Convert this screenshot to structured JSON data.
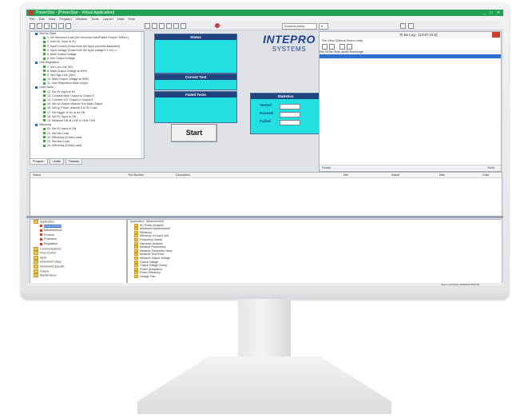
{
  "app": {
    "title": "PowerStar - [PowerStar - Virtual Application]",
    "window_controls": "_ □ ✕",
    "menu": [
      "File",
      "Edit",
      "View",
      "Program",
      "Window",
      "Tools",
      "Launch",
      "Data",
      "Help"
    ],
    "toolbar_combos": [
      "Autotest setup",
      "▾"
    ]
  },
  "colors": {
    "titlebar": "#21a152",
    "panel_header": "#20447e",
    "panel_fill": "#22e0e0",
    "logo": "#1f3f91",
    "selection": "#2f6fd0"
  },
  "tree": {
    "rows": [
      {
        "text": "Test for Tests",
        "type": "hd"
      },
      {
        "text": "1. Vin Minimum Load (Vin minimum load/Rated Output / 5Whrs.)",
        "type": "tk"
      },
      {
        "text": "2. Vout 5V, Input to 5V",
        "type": "tk"
      },
      {
        "text": "3. Input Current (Draw from the input current's datasheet)",
        "type": "tk"
      },
      {
        "text": "4. Input Voltage (Draw from the input voltage's 1.4V) <=",
        "type": "tk"
      },
      {
        "text": "5. Main Output Voltage",
        "type": "tk"
      },
      {
        "text": "6. Aux Output Voltage",
        "type": "tk"
      },
      {
        "text": "Line Regulation",
        "type": "hd"
      },
      {
        "text": "7. Set Low Line (5V)",
        "type": "tk"
      },
      {
        "text": "8. Main Output Voltage at 90Hz",
        "type": "tk"
      },
      {
        "text": "9. Set High Line (26V)",
        "type": "tk"
      },
      {
        "text": "10. Main Output Voltage at 90Hz",
        "type": "tk"
      },
      {
        "text": "11. Line Regulation Main Output",
        "type": "tk"
      },
      {
        "text": "Load Value",
        "type": "hd"
      },
      {
        "text": "12. Set 5V Input to 5V",
        "type": "tk"
      },
      {
        "text": "13. Connect Main Output to Output 5",
        "type": "tk"
      },
      {
        "text": "14. Connect 12V Output to Output 6",
        "type": "tk"
      },
      {
        "text": "15. Set up Output channel 5 to Main Output",
        "type": "tk"
      },
      {
        "text": "16. Set up Power channel 6 to 5V Load",
        "type": "tk"
      },
      {
        "text": "17. Set trigger to 5V at an ON",
        "type": "tk"
      },
      {
        "text": "18. Set 5V Input to ON",
        "type": "tk"
      },
      {
        "text": "19. Measure ON at CHN & CHN CHN",
        "type": "tk"
      },
      {
        "text": "Efficiency",
        "type": "hd"
      },
      {
        "text": "20. Set 5V Input to ON",
        "type": "tk"
      },
      {
        "text": "21. Set Min Load",
        "type": "tk"
      },
      {
        "text": "22. Efficiency (8 Max Load)",
        "type": "tk"
      },
      {
        "text": "23. Set Max Load",
        "type": "tk"
      },
      {
        "text": "24. Efficiency (8 Max Load)",
        "type": "tk"
      }
    ],
    "tabs": [
      "Program",
      "Limits",
      "Fixtures"
    ]
  },
  "panels": {
    "status_label": "Status",
    "current_test_label": "Current Test",
    "failed_tests_label": "Failed Tests",
    "start_label": "Start",
    "logo_line1": "INTEPRO",
    "logo_line2": "SYSTEMS",
    "statistics_label": "Statistics",
    "tested_label": "Tested",
    "passed_label": "Passed",
    "failed_label": "Failed"
  },
  "log": {
    "title": "Ts Bs Log - [13:57:03.0]",
    "menu": "File  View  Options  Search  Help",
    "columns": "Nbr    Ts/Tac    Ts/ac    ad/dB    Rmessage",
    "status_left": "Ready",
    "status_right": "Build"
  },
  "results": {
    "columns": [
      {
        "label": "Status"
      },
      {
        "label": "Test Number"
      },
      {
        "label": "Description"
      },
      {
        "label": "Min"
      },
      {
        "label": "Actual"
      },
      {
        "label": "Max"
      },
      {
        "label": "Units"
      }
    ]
  },
  "bottom_tree": {
    "rows": [
      {
        "text": "Application",
        "kind": "fold"
      },
      {
        "text": "Measurement",
        "kind": "red",
        "selected": true
      },
      {
        "text": "Miscellaneous",
        "kind": "red"
      },
      {
        "text": "Process",
        "kind": "red"
      },
      {
        "text": "Protection",
        "kind": "red"
      },
      {
        "text": "Regulation",
        "kind": "red"
      },
      {
        "text": "Communications",
        "kind": "fold"
      },
      {
        "text": "Flow Control",
        "kind": "fold"
      },
      {
        "text": "Input",
        "kind": "fold"
      },
      {
        "text": "Instrument Class",
        "kind": "fold"
      },
      {
        "text": "Instrument Specific",
        "kind": "fold"
      },
      {
        "text": "Output",
        "kind": "fold"
      },
      {
        "text": "Maintenance",
        "kind": "fold"
      }
    ]
  },
  "measurement_list": {
    "header": "Application - Measurement",
    "items": [
      "AC Power Analysis",
      "Advanced Measurement",
      "Efficiency",
      "Efficiency Vs Input Line",
      "Frequency Sweep",
      "Harmonic Analysis",
      "Measure Parameters",
      "Measure Parameter Value",
      "Measure Test Point",
      "Measure Output Voltage",
      "Output Voltage",
      "Output Voltage Swing",
      "Power Dissipation",
      "Power Efficiency",
      "Voltage Trim"
    ]
  },
  "statusbar": {
    "text": "Start Local Mode   ADMINISTRATOR"
  }
}
